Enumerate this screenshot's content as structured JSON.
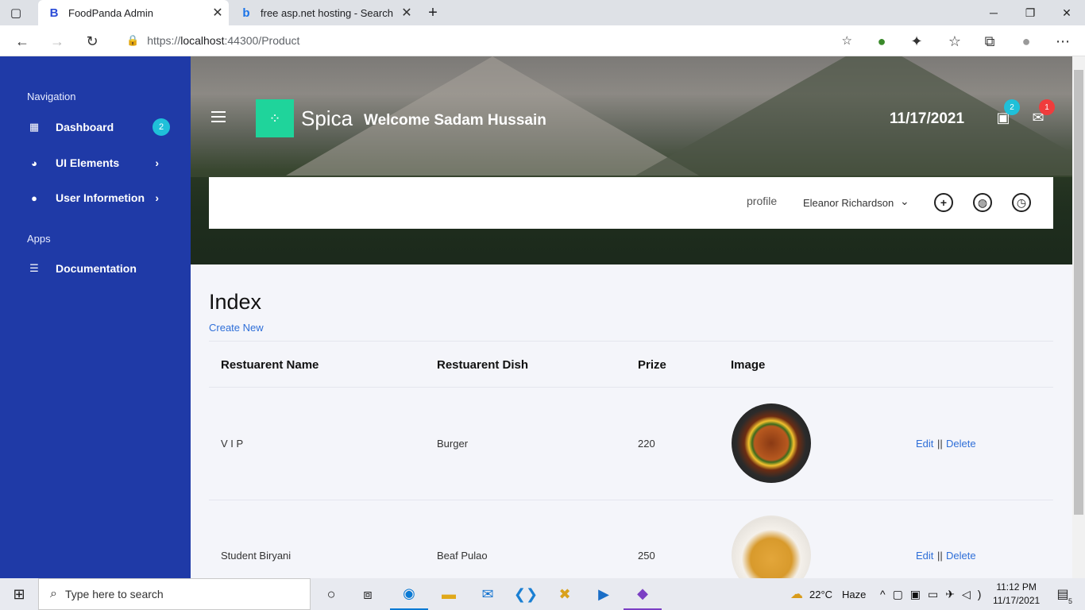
{
  "browser": {
    "tabs": [
      {
        "title": "FoodPanda Admin",
        "icon": "B"
      },
      {
        "title": "free asp.net hosting - Search",
        "icon": "b"
      }
    ],
    "url_prefix": "https://",
    "url_host": "localhost",
    "url_rest": ":44300/Product"
  },
  "sidebar": {
    "section_nav": "Navigation",
    "items": [
      {
        "label": "Dashboard",
        "icon": "grid-icon",
        "badge": "2"
      },
      {
        "label": "UI Elements",
        "icon": "palette-icon"
      },
      {
        "label": "User Informetion",
        "icon": "user-icon"
      }
    ],
    "section_apps": "Apps",
    "apps": [
      {
        "label": "Documentation",
        "icon": "document-icon"
      }
    ]
  },
  "header": {
    "brand": "Spica",
    "welcome": "Welcome Sadam Hussain",
    "date": "11/17/2021",
    "notif_badge": "2",
    "mail_badge": "1",
    "profile_alt": "profile",
    "user_name": "Eleanor Richardson"
  },
  "page": {
    "title": "Index",
    "create_link": "Create New",
    "columns": [
      "Restuarent Name",
      "Restuarent Dish",
      "Prize",
      "Image"
    ],
    "rows": [
      {
        "name": "V I P",
        "dish": "Burger",
        "prize": "220",
        "image": "burger",
        "edit": "Edit",
        "sep": "||",
        "delete": "Delete"
      },
      {
        "name": "Student Biryani",
        "dish": "Beaf Pulao",
        "prize": "250",
        "image": "noodles",
        "edit": "Edit",
        "sep": "||",
        "delete": "Delete"
      }
    ]
  },
  "taskbar": {
    "search_placeholder": "Type here to search",
    "weather": "22°C",
    "weather_desc": "Haze",
    "time": "11:12 PM",
    "date": "11/17/2021",
    "notif_count": "5"
  },
  "colors": {
    "sidebar": "#1f3aa7",
    "accent": "#1fd49b",
    "badge_teal": "#1fc0d9",
    "badge_red": "#f03c3c",
    "link": "#2f6fd8"
  }
}
